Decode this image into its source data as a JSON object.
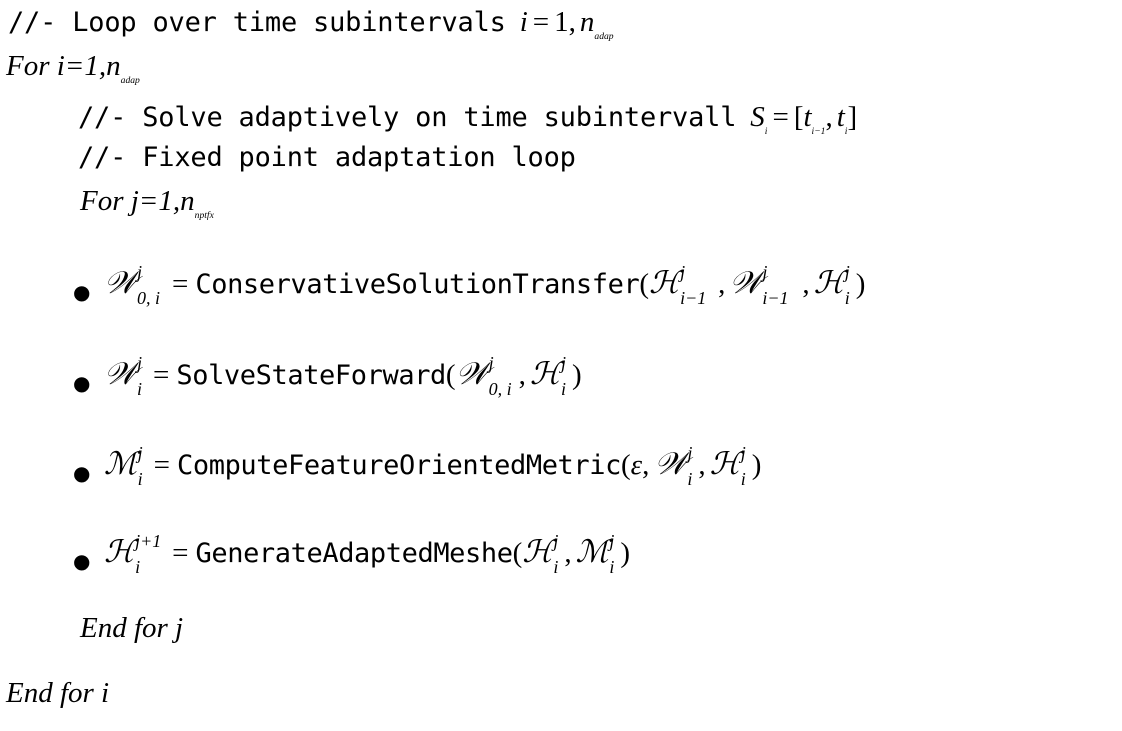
{
  "document": {
    "kind": "algorithm-pseudocode",
    "background_color": "#ffffff",
    "text_color": "#000000"
  },
  "lines": [
    {
      "id": "comment-loop-subintervals",
      "type": "comment",
      "text": "//- Loop over time subintervals",
      "math_tail": "i = 1, n_adap"
    },
    {
      "id": "for-i",
      "type": "keyword",
      "text": "For i=1,",
      "var": "n",
      "subscript": "adap"
    },
    {
      "id": "comment-solve-adaptively",
      "type": "comment",
      "text": "//- Solve adaptively on time subintervall",
      "math_tail": "S_i = [t_{i-1}, t_i]"
    },
    {
      "id": "comment-fixed-point",
      "type": "comment",
      "text": "//- Fixed point adaptation loop"
    },
    {
      "id": "for-j",
      "type": "keyword",
      "text": "For j=1,",
      "var": "n",
      "subscript": "nptfx"
    },
    {
      "id": "end-for-j",
      "type": "keyword",
      "text": "End for j"
    },
    {
      "id": "end-for-i",
      "type": "keyword",
      "text": "End for i"
    }
  ],
  "glyphs": {
    "bullet": "●",
    "equals": "=",
    "comma": ",",
    "lparen": "(",
    "rparen": ")",
    "lbracket": "[",
    "rbracket": "]",
    "minus": "−",
    "plus": "+",
    "epsilon": "ε",
    "script_W": "𝒲",
    "script_H": "ℋ",
    "script_M": "ℳ",
    "S": "S",
    "t": "t",
    "i": "i",
    "j": "j",
    "one": "1",
    "zero": "0"
  },
  "steps": [
    {
      "id": "step-conservative-solution-transfer",
      "lhs_symbol": "𝒲",
      "lhs_sup": "j",
      "lhs_sub": "0, i",
      "function": "ConservativeSolutionTransfer",
      "args": [
        {
          "symbol": "ℋ",
          "sup": "j",
          "sub": "i−1"
        },
        {
          "symbol": "𝒲",
          "sup": "j",
          "sub": "i−1"
        },
        {
          "symbol": "ℋ",
          "sup": "j",
          "sub": "i"
        }
      ]
    },
    {
      "id": "step-solve-state-forward",
      "lhs_symbol": "𝒲",
      "lhs_sup": "j",
      "lhs_sub": "i",
      "function": "SolveStateForward",
      "args": [
        {
          "symbol": "𝒲",
          "sup": "j",
          "sub": "0, i"
        },
        {
          "symbol": "ℋ",
          "sup": "j",
          "sub": "i"
        }
      ]
    },
    {
      "id": "step-compute-feature-oriented-metric",
      "lhs_symbol": "ℳ",
      "lhs_sup": "j",
      "lhs_sub": "i",
      "function": "ComputeFeatureOrientedMetric",
      "args": [
        {
          "symbol": "ε",
          "sup": "",
          "sub": ""
        },
        {
          "symbol": "𝒲",
          "sup": "j",
          "sub": "i"
        },
        {
          "symbol": "ℋ",
          "sup": "j",
          "sub": "i"
        }
      ]
    },
    {
      "id": "step-generate-adapted-meshe",
      "lhs_symbol": "ℋ",
      "lhs_sup": "j+1",
      "lhs_sub": "i",
      "function": "GenerateAdaptedMeshe",
      "args": [
        {
          "symbol": "ℋ",
          "sup": "j",
          "sub": "i"
        },
        {
          "symbol": "ℳ",
          "sup": "j",
          "sub": "i"
        }
      ]
    }
  ],
  "text": {
    "comment_1": "//- Loop over time subintervals",
    "comment_2": "//- Solve adaptively on time subintervall",
    "comment_3": "//- Fixed point adaptation loop",
    "for_i": "For i=1,",
    "for_j": "For j=1,",
    "end_for_j": "End for j",
    "end_for_i": "End for i",
    "n": "n",
    "sub_adap": "adap",
    "sub_nptfx": "nptfx",
    "eq": "=",
    "one": "1",
    "comma": ",",
    "i": "i",
    "S": "S",
    "t": "t",
    "lbracket": "[",
    "rbracket": "]",
    "i_minus_1": "i−1",
    "fn_1": "ConservativeSolutionTransfer",
    "fn_2": "SolveStateForward",
    "fn_3": "ComputeFeatureOrientedMetric",
    "fn_4": "GenerateAdaptedMeshe",
    "W": "𝒲",
    "H": "ℋ",
    "M": "ℳ",
    "epsilon": "ε",
    "j": "j",
    "j_plus_1": "j+1",
    "sub_0i": "0, i",
    "lparen": "(",
    "rparen": ")",
    "bullet": "●"
  }
}
